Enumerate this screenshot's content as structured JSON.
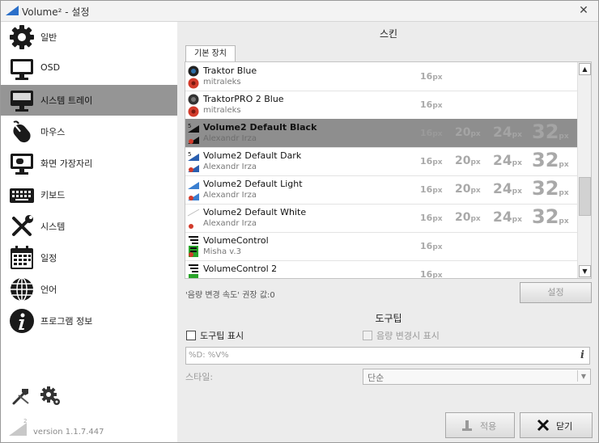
{
  "window": {
    "title": "Volume² - 설정",
    "close_icon": "close-icon"
  },
  "sidebar": {
    "items": [
      {
        "label": "일반",
        "icon": "gear-icon"
      },
      {
        "label": "OSD",
        "icon": "monitor-icon"
      },
      {
        "label": "시스템 트레이",
        "icon": "system-tray-icon"
      },
      {
        "label": "마우스",
        "icon": "mouse-icon"
      },
      {
        "label": "화면 가장자리",
        "icon": "screen-edge-icon"
      },
      {
        "label": "키보드",
        "icon": "keyboard-icon"
      },
      {
        "label": "시스템",
        "icon": "tools-icon"
      },
      {
        "label": "일정",
        "icon": "calendar-icon"
      },
      {
        "label": "언어",
        "icon": "globe-icon"
      },
      {
        "label": "프로그램 정보",
        "icon": "info-icon"
      }
    ],
    "selected": "시스템 트레이",
    "version": "version 1.1.7.447"
  },
  "skins": {
    "title": "스킨",
    "tab": "기본 장치",
    "list": [
      {
        "name": "Traktor Blue",
        "author": "mitraleks",
        "sizes": [
          "16"
        ]
      },
      {
        "name": "TraktorPRO 2 Blue",
        "author": "mitraleks",
        "sizes": [
          "16"
        ]
      },
      {
        "name": "Volume2 Default Black",
        "author": "Alexandr Irza",
        "sizes": [
          "16",
          "20",
          "24",
          "32"
        ],
        "selected": true
      },
      {
        "name": "Volume2 Default Dark",
        "author": "Alexandr Irza",
        "sizes": [
          "16",
          "20",
          "24",
          "32"
        ]
      },
      {
        "name": "Volume2 Default Light",
        "author": "Alexandr Irza",
        "sizes": [
          "16",
          "20",
          "24",
          "32"
        ]
      },
      {
        "name": "Volume2 Default White",
        "author": "Alexandr Irza",
        "sizes": [
          "16",
          "20",
          "24",
          "32"
        ]
      },
      {
        "name": "VolumeControl",
        "author": "Misha v.3",
        "sizes": [
          "16"
        ]
      },
      {
        "name": "VolumeControl 2",
        "author": "",
        "sizes": [
          "16"
        ]
      }
    ],
    "px_unit": "px",
    "hint": "'음량 변경 속도' 권장 값:0",
    "settings_button": "설정"
  },
  "tooltip": {
    "title": "도구팁",
    "show_label": "도구팁 표시",
    "show_checked": false,
    "volume_change_label": "음량 변경시 표시",
    "format_value": "%D: %V%",
    "style_label": "스타일:",
    "style_value": "단순"
  },
  "footer": {
    "apply_label": "적용",
    "close_label": "닫기"
  },
  "colors": {
    "selection": "#959595",
    "sidebar_bg": "#ffffff",
    "panel_bg": "#ececec"
  }
}
